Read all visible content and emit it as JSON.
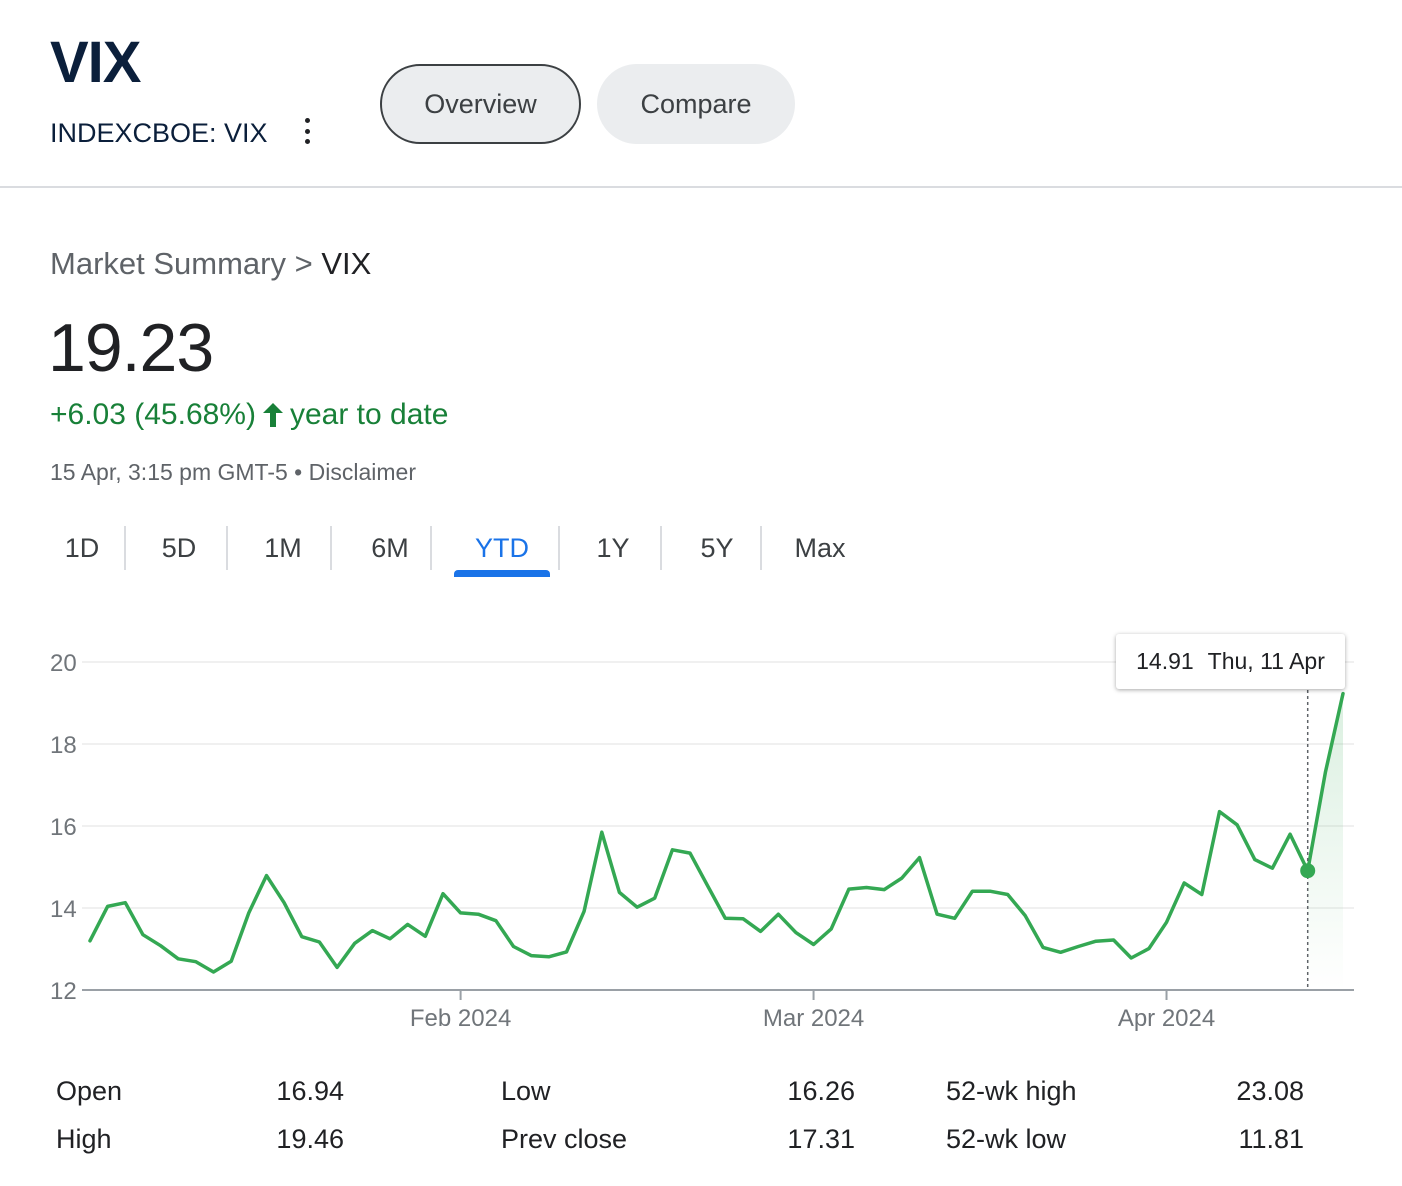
{
  "header": {
    "ticker": "VIX",
    "exchange": "INDEXCBOE: VIX",
    "more_icon": "more-vertical-icon",
    "tabs": [
      {
        "label": "Overview",
        "selected": true
      },
      {
        "label": "Compare",
        "selected": false
      }
    ]
  },
  "summary": {
    "breadcrumb_root": "Market Summary",
    "breadcrumb_sep": " > ",
    "breadcrumb_current": "VIX",
    "price": "19.23",
    "change": "+6.03 (45.68%)",
    "change_icon": "arrow-up-icon",
    "change_suffix": "year to date",
    "change_color": "#188038",
    "timestamp": "15 Apr, 3:15 pm GMT-5",
    "separator": " • ",
    "disclaimer": "Disclaimer"
  },
  "ranges": [
    {
      "label": "1D",
      "active": false
    },
    {
      "label": "5D",
      "active": false
    },
    {
      "label": "1M",
      "active": false
    },
    {
      "label": "6M",
      "active": false
    },
    {
      "label": "YTD",
      "active": true
    },
    {
      "label": "1Y",
      "active": false
    },
    {
      "label": "5Y",
      "active": false
    },
    {
      "label": "Max",
      "active": false
    }
  ],
  "tooltip": {
    "value": "14.91",
    "date": "Thu, 11 Apr"
  },
  "chart_data": {
    "type": "line",
    "line_color": "#34a853",
    "ylim": [
      12,
      20
    ],
    "y_ticks": [
      "20",
      "18",
      "16",
      "14",
      "12"
    ],
    "x_ticks": [
      "Feb 2024",
      "Mar 2024",
      "Apr 2024"
    ],
    "grid": true,
    "highlighted_point": {
      "value": 14.91,
      "date": "Thu, 11 Apr"
    },
    "series": [
      {
        "values": [
          13.2,
          14.04,
          14.13,
          13.35,
          13.08,
          12.76,
          12.69,
          12.44,
          12.7,
          13.88,
          14.79,
          14.13,
          13.3,
          13.17,
          12.55,
          13.14,
          13.45,
          13.25,
          13.6,
          13.31,
          14.35,
          13.88,
          13.85,
          13.69,
          13.06,
          12.84,
          12.81,
          12.93,
          13.92,
          15.85,
          14.38,
          14.02,
          14.24,
          15.42,
          15.34,
          14.54,
          13.75,
          13.74,
          13.43,
          13.85,
          13.4,
          13.11,
          13.49,
          14.46,
          14.5,
          14.45,
          14.73,
          15.23,
          13.85,
          13.75,
          14.41,
          14.41,
          14.33,
          13.81,
          13.04,
          12.92,
          13.06,
          13.19,
          13.22,
          12.78,
          13.01,
          13.65,
          14.61,
          14.33,
          16.35,
          16.03,
          15.18,
          14.97,
          15.8,
          14.91,
          17.31,
          19.23
        ]
      }
    ]
  },
  "stats": [
    {
      "label": "Open",
      "value": "16.94"
    },
    {
      "label": "High",
      "value": "19.46"
    },
    {
      "label": "Low",
      "value": "16.26"
    },
    {
      "label": "Prev close",
      "value": "17.31"
    },
    {
      "label": "52-wk high",
      "value": "23.08"
    },
    {
      "label": "52-wk low",
      "value": "11.81"
    }
  ]
}
